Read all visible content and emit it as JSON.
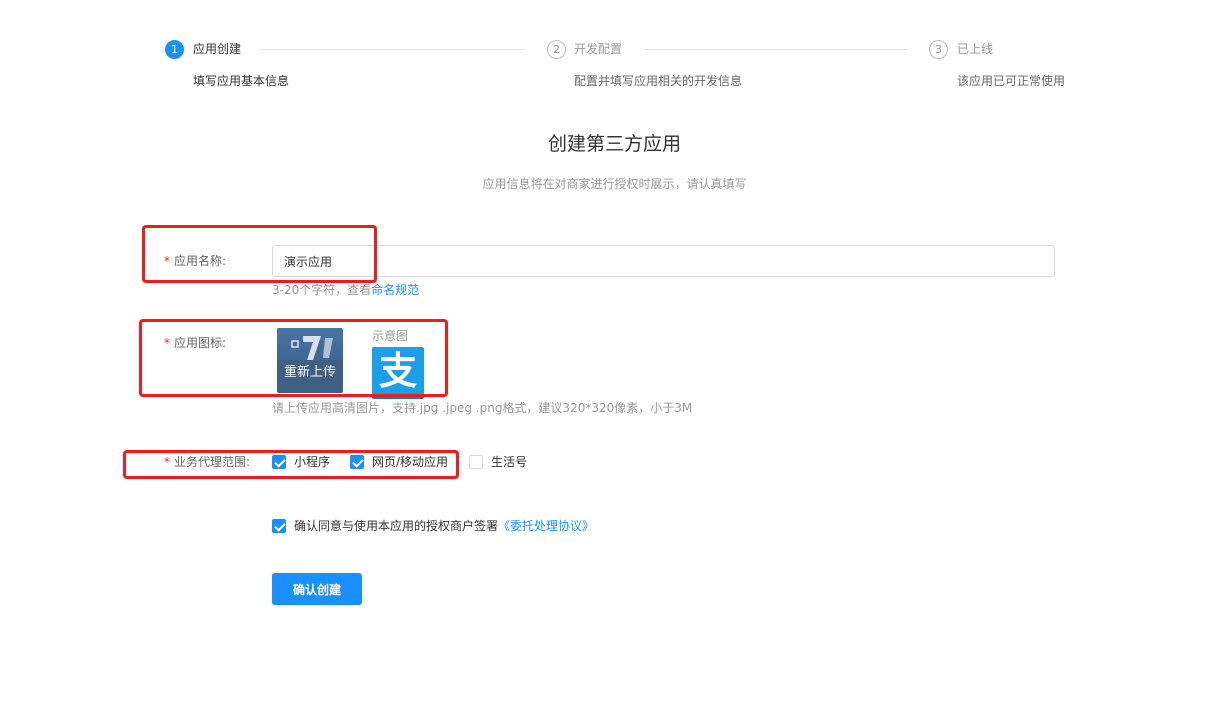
{
  "steps": [
    {
      "num": "1",
      "title": "应用创建",
      "desc": "填写应用基本信息"
    },
    {
      "num": "2",
      "title": "开发配置",
      "desc": "配置并填写应用相关的开发信息"
    },
    {
      "num": "3",
      "title": "已上线",
      "desc": "该应用已可正常使用"
    }
  ],
  "header": {
    "title": "创建第三方应用",
    "subtitle": "应用信息将在对商家进行授权时展示，请认真填写"
  },
  "form": {
    "required_mark": "*",
    "name": {
      "label": "应用名称:",
      "value": "演示应用",
      "hint_prefix": "3-20个字符，查看",
      "hint_link": "命名规范"
    },
    "icon": {
      "label": "应用图标:",
      "reupload_label": "重新上传",
      "example_label": "示意图",
      "example_glyph": "支",
      "hint": "请上传应用高清图片，支持.jpg .jpeg .png格式，建议320*320像素，小于3M"
    },
    "scope": {
      "label": "业务代理范围:",
      "options": [
        {
          "label": "小程序",
          "checked": true
        },
        {
          "label": "网页/移动应用",
          "checked": true
        },
        {
          "label": "生活号",
          "checked": false
        }
      ]
    },
    "agreement": {
      "checked": true,
      "text": "确认同意与使用本应用的授权商户签署",
      "link": "《委托处理协议》"
    },
    "submit_label": "确认创建"
  },
  "colors": {
    "primary": "#1890ff",
    "required": "#f5222d",
    "annotation_box": "#ee1c1c",
    "alipay_blue": "#1a9fe8"
  }
}
